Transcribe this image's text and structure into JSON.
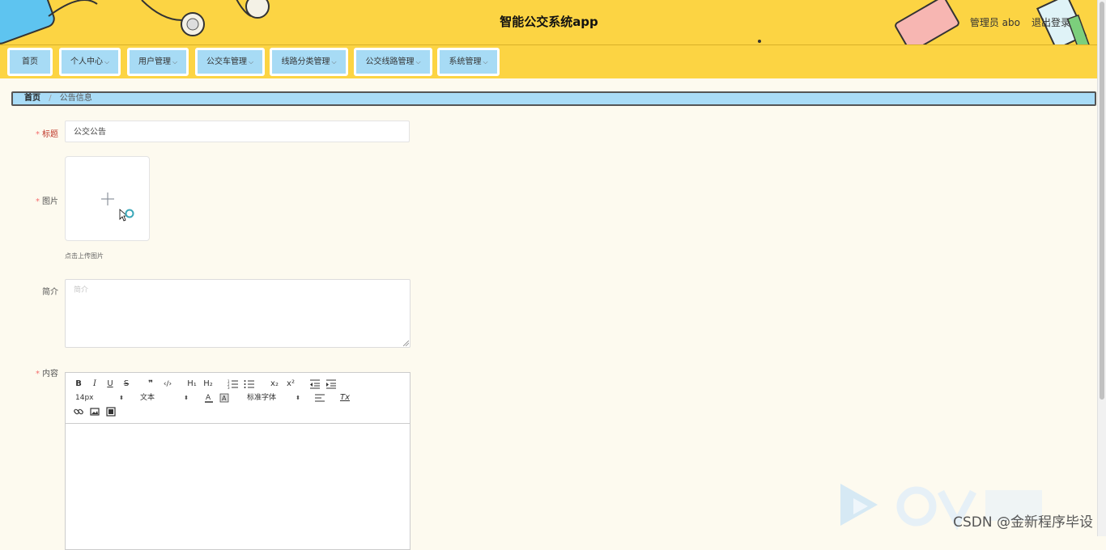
{
  "header": {
    "title": "智能公交系统app",
    "user": "管理员 abo",
    "logout": "退出登录"
  },
  "nav": [
    {
      "label": "首页",
      "dropdown": false
    },
    {
      "label": "个人中心",
      "dropdown": true
    },
    {
      "label": "用户管理",
      "dropdown": true
    },
    {
      "label": "公交车管理",
      "dropdown": true
    },
    {
      "label": "线路分类管理",
      "dropdown": true
    },
    {
      "label": "公交线路管理",
      "dropdown": true
    },
    {
      "label": "系统管理",
      "dropdown": true
    }
  ],
  "breadcrumb": {
    "home": "首页",
    "separator": "/",
    "current": "公告信息"
  },
  "form": {
    "required_mark": "*",
    "title_label": "标题",
    "title_value": "公交公告",
    "image_label": "图片",
    "upload_tip": "点击上传图片",
    "intro_label": "简介",
    "intro_placeholder": "简介",
    "content_label": "内容"
  },
  "editor": {
    "font_size": "14px",
    "paragraph": "文本",
    "font_family": "标准字体",
    "bold": "B",
    "italic": "I",
    "underline": "U",
    "strike": "S",
    "quote": "❞",
    "code": "‹/›",
    "h1": "H₁",
    "h2": "H₂",
    "subscript": "x₂",
    "superscript": "x²",
    "clear_format": "Tx"
  },
  "watermark": "CSDN @金新程序毕设",
  "colors": {
    "header_bg": "#fcd443",
    "nav_item_bg": "#a7dbf5",
    "page_bg": "#fdfaef",
    "required": "#f56c6c"
  }
}
